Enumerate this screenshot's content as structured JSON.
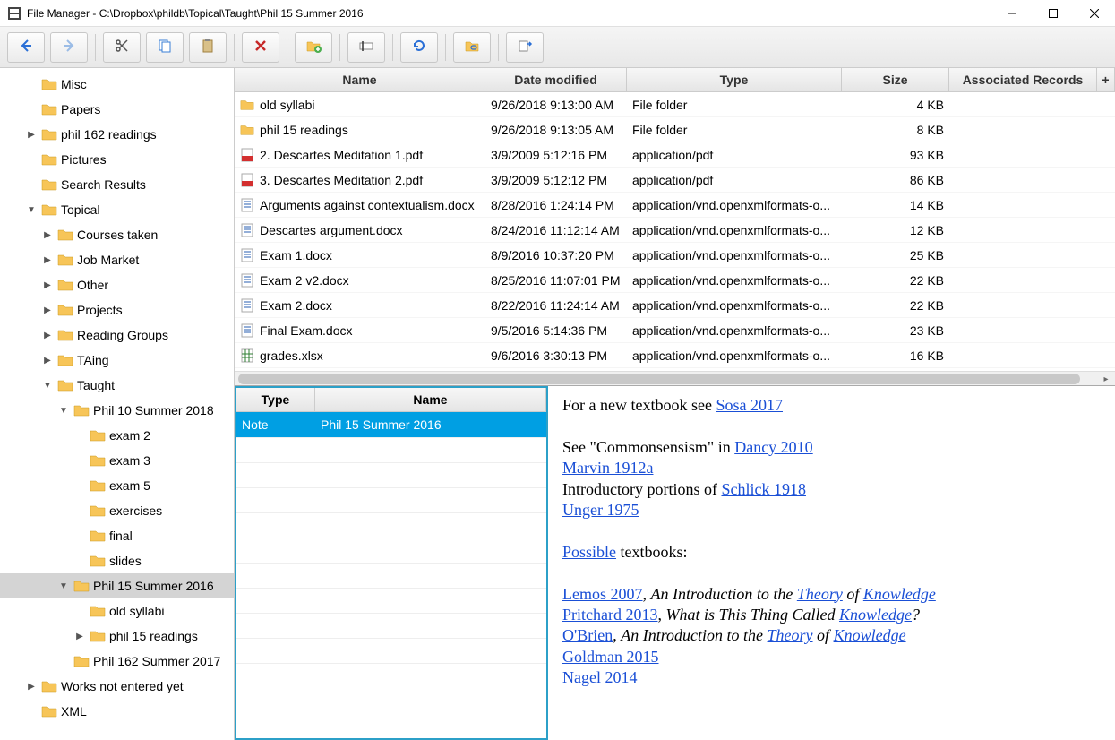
{
  "window": {
    "title": "File Manager - C:\\Dropbox\\phildb\\Topical\\Taught\\Phil 15 Summer 2016"
  },
  "toolbar": {
    "items": [
      {
        "name": "back-button",
        "icon": "arrow-left"
      },
      {
        "name": "forward-button",
        "icon": "arrow-right"
      },
      {
        "sep": true
      },
      {
        "name": "cut-button",
        "icon": "scissors"
      },
      {
        "name": "copy-button",
        "icon": "copy"
      },
      {
        "name": "paste-button",
        "icon": "paste"
      },
      {
        "sep": true
      },
      {
        "name": "delete-button",
        "icon": "delete"
      },
      {
        "sep": true
      },
      {
        "name": "new-folder-button",
        "icon": "new-folder"
      },
      {
        "sep": true
      },
      {
        "name": "rename-button",
        "icon": "rename"
      },
      {
        "sep": true
      },
      {
        "name": "refresh-button",
        "icon": "refresh"
      },
      {
        "sep": true
      },
      {
        "name": "link-button",
        "icon": "link"
      },
      {
        "sep": true
      },
      {
        "name": "export-button",
        "icon": "export"
      }
    ]
  },
  "tree": [
    {
      "depth": 1,
      "exp": null,
      "label": "Misc"
    },
    {
      "depth": 1,
      "exp": null,
      "label": "Papers"
    },
    {
      "depth": 1,
      "exp": false,
      "label": "phil 162 readings"
    },
    {
      "depth": 1,
      "exp": null,
      "label": "Pictures"
    },
    {
      "depth": 1,
      "exp": null,
      "label": "Search Results"
    },
    {
      "depth": 1,
      "exp": true,
      "label": "Topical"
    },
    {
      "depth": 2,
      "exp": false,
      "label": "Courses taken"
    },
    {
      "depth": 2,
      "exp": false,
      "label": "Job Market"
    },
    {
      "depth": 2,
      "exp": false,
      "label": "Other"
    },
    {
      "depth": 2,
      "exp": false,
      "label": "Projects"
    },
    {
      "depth": 2,
      "exp": false,
      "label": "Reading Groups"
    },
    {
      "depth": 2,
      "exp": false,
      "label": "TAing"
    },
    {
      "depth": 2,
      "exp": true,
      "label": "Taught"
    },
    {
      "depth": 3,
      "exp": true,
      "label": "Phil 10 Summer 2018"
    },
    {
      "depth": 4,
      "exp": null,
      "label": "exam 2"
    },
    {
      "depth": 4,
      "exp": null,
      "label": "exam 3"
    },
    {
      "depth": 4,
      "exp": null,
      "label": "exam 5"
    },
    {
      "depth": 4,
      "exp": null,
      "label": "exercises"
    },
    {
      "depth": 4,
      "exp": null,
      "label": "final"
    },
    {
      "depth": 4,
      "exp": null,
      "label": "slides"
    },
    {
      "depth": 3,
      "exp": true,
      "label": "Phil 15 Summer 2016",
      "selected": true
    },
    {
      "depth": 4,
      "exp": null,
      "label": "old syllabi"
    },
    {
      "depth": 4,
      "exp": false,
      "label": "phil 15 readings"
    },
    {
      "depth": 3,
      "exp": null,
      "label": "Phil 162 Summer 2017"
    },
    {
      "depth": 1,
      "exp": false,
      "label": "Works not entered yet"
    },
    {
      "depth": 1,
      "exp": null,
      "label": "XML"
    }
  ],
  "fileColumns": {
    "name": "Name",
    "date": "Date modified",
    "type": "Type",
    "size": "Size",
    "assoc": "Associated Records"
  },
  "files": [
    {
      "icon": "folder",
      "name": "old syllabi",
      "date": "9/26/2018 9:13:00 AM",
      "type": "File folder",
      "size": "4 KB"
    },
    {
      "icon": "folder",
      "name": "phil 15 readings",
      "date": "9/26/2018 9:13:05 AM",
      "type": "File folder",
      "size": "8 KB"
    },
    {
      "icon": "pdf",
      "name": "2. Descartes Meditation 1.pdf",
      "date": "3/9/2009 5:12:16 PM",
      "type": "application/pdf",
      "size": "93 KB"
    },
    {
      "icon": "pdf",
      "name": "3. Descartes Meditation 2.pdf",
      "date": "3/9/2009 5:12:12 PM",
      "type": "application/pdf",
      "size": "86 KB"
    },
    {
      "icon": "docx",
      "name": "Arguments against contextualism.docx",
      "date": "8/28/2016 1:24:14 PM",
      "type": "application/vnd.openxmlformats-o...",
      "size": "14 KB"
    },
    {
      "icon": "docx",
      "name": "Descartes argument.docx",
      "date": "8/24/2016 11:12:14 AM",
      "type": "application/vnd.openxmlformats-o...",
      "size": "12 KB"
    },
    {
      "icon": "docx",
      "name": "Exam 1.docx",
      "date": "8/9/2016 10:37:20 PM",
      "type": "application/vnd.openxmlformats-o...",
      "size": "25 KB"
    },
    {
      "icon": "docx",
      "name": "Exam 2 v2.docx",
      "date": "8/25/2016 11:07:01 PM",
      "type": "application/vnd.openxmlformats-o...",
      "size": "22 KB"
    },
    {
      "icon": "docx",
      "name": "Exam 2.docx",
      "date": "8/22/2016 11:24:14 AM",
      "type": "application/vnd.openxmlformats-o...",
      "size": "22 KB"
    },
    {
      "icon": "docx",
      "name": "Final Exam.docx",
      "date": "9/5/2016 5:14:36 PM",
      "type": "application/vnd.openxmlformats-o...",
      "size": "23 KB"
    },
    {
      "icon": "xlsx",
      "name": "grades.xlsx",
      "date": "9/6/2016 3:30:13 PM",
      "type": "application/vnd.openxmlformats-o...",
      "size": "16 KB"
    }
  ],
  "recordsHeader": {
    "type": "Type",
    "name": "Name"
  },
  "records": [
    {
      "type": "Note",
      "name": "Phil 15 Summer 2016",
      "selected": true
    }
  ],
  "preview": {
    "line1_a": "For a new textbook see ",
    "link1": "Sosa 2017",
    "line2_a": "See \"Commonsensism\" in ",
    "link2": "Dancy 2010",
    "link3": "Marvin 1912a",
    "line3_a": "Introductory portions of ",
    "link4": "Schlick 1918",
    "link5": "Unger 1975",
    "link6": "Possible",
    "line4_a": " textbooks:",
    "link7": "Lemos 2007",
    "ital1_a": "An Introduction to the ",
    "link8": "Theory",
    "ital1_b": " of ",
    "link9": "Knowledge",
    "link10": "Pritchard 2013",
    "ital2_a": "What is This Thing Called ",
    "link11": "Knowledge",
    "ital2_b": "?",
    "link12": "O'Brien",
    "ital3_a": "An Introduction to the ",
    "link13": "Theory",
    "ital3_b": " of ",
    "link14": "Knowledge",
    "link15": "Goldman 2015",
    "link16": "Nagel 2014"
  }
}
